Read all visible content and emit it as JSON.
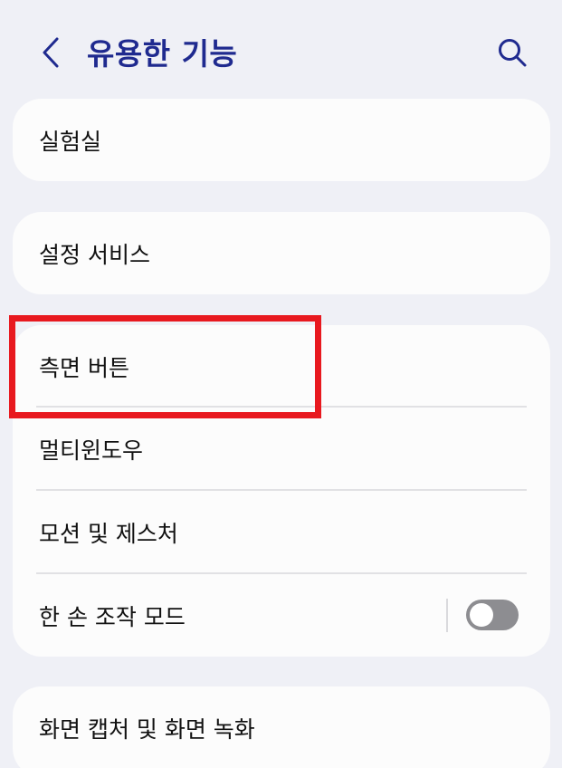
{
  "header": {
    "title": "유용한 기능",
    "back_icon": "chevron-left-icon",
    "search_icon": "search-icon"
  },
  "cards": [
    {
      "items": [
        {
          "label": "실험실"
        }
      ]
    },
    {
      "items": [
        {
          "label": "설정 서비스"
        }
      ]
    },
    {
      "items": [
        {
          "label": "측면 버튼",
          "highlighted": true
        },
        {
          "label": "멀티윈도우"
        },
        {
          "label": "모션 및 제스처"
        },
        {
          "label": "한 손 조작 모드",
          "toggle": "off"
        }
      ]
    },
    {
      "items": [
        {
          "label": "화면 캡처 및 화면 녹화"
        }
      ]
    }
  ],
  "colors": {
    "background": "#eff0f6",
    "card": "#fcfcfc",
    "title": "#1f2a8f",
    "highlight": "#e8191f",
    "toggle_off": "#8d8d91"
  }
}
